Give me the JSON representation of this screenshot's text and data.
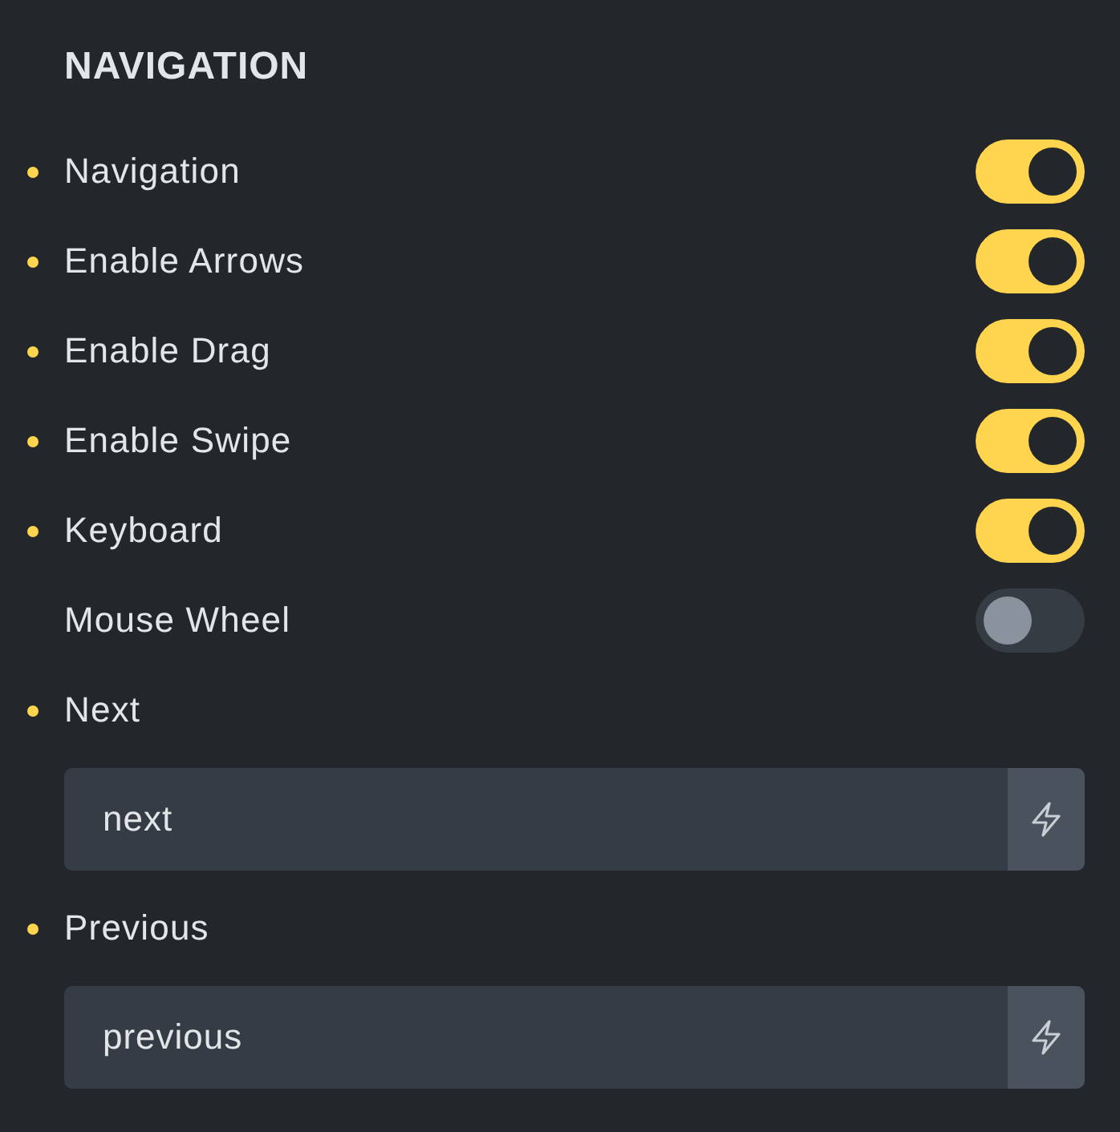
{
  "section": {
    "title": "NAVIGATION"
  },
  "controls": [
    {
      "kind": "toggle",
      "label": "Navigation",
      "modified": true,
      "on": true
    },
    {
      "kind": "toggle",
      "label": "Enable Arrows",
      "modified": true,
      "on": true
    },
    {
      "kind": "toggle",
      "label": "Enable Drag",
      "modified": true,
      "on": true
    },
    {
      "kind": "toggle",
      "label": "Enable Swipe",
      "modified": true,
      "on": true
    },
    {
      "kind": "toggle",
      "label": "Keyboard",
      "modified": true,
      "on": true
    },
    {
      "kind": "toggle",
      "label": "Mouse Wheel",
      "modified": false,
      "on": false
    },
    {
      "kind": "text",
      "label": "Next",
      "modified": true,
      "value": "next"
    },
    {
      "kind": "text",
      "label": "Previous",
      "modified": true,
      "value": "previous"
    }
  ]
}
